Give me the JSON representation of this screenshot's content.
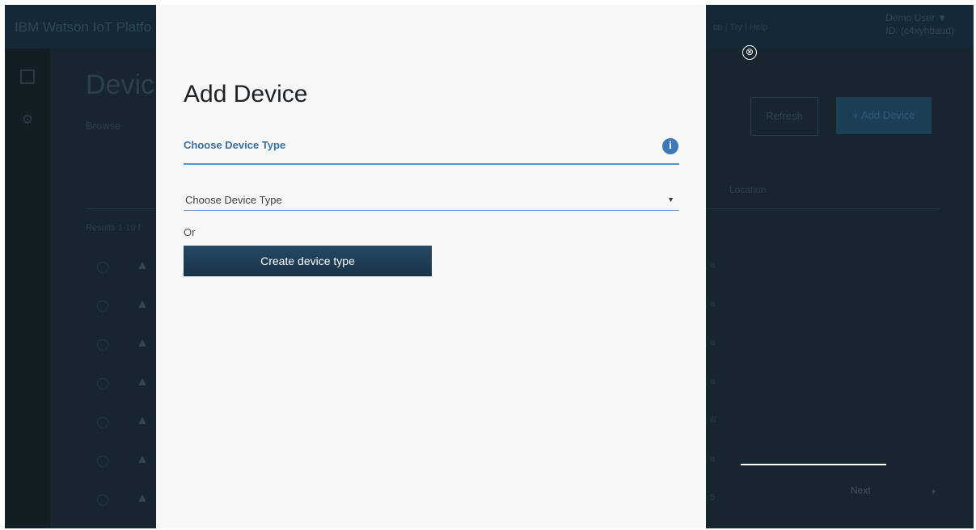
{
  "background": {
    "brand": "IBM Watson IoT Platfo",
    "user_name": "Demo User ▼",
    "org_id": "ID: (c4xyhbaud)",
    "topbar_links": "ce  |  Try  |  Help",
    "page_title": "Devic",
    "browse_tab": "Browse",
    "refresh_label": "Refresh",
    "add_device_label": "+ Add Device",
    "location_header": "Location",
    "results_text": "Results 1-10 f",
    "row_fragments": [
      "a",
      "a",
      "a",
      "a",
      "ill",
      "a",
      "5"
    ],
    "next_label": "Next"
  },
  "modal": {
    "title": "Add Device",
    "section_label": "Choose Device Type",
    "select_placeholder": "Choose Device Type",
    "or_text": "Or",
    "create_button": "Create device type",
    "close_icon": "⊗"
  },
  "icons": {
    "info": "i",
    "warning": "▲"
  },
  "colors": {
    "accent_blue": "#3e79b5",
    "button_navy": "#1f3f58",
    "overlay_bg": "#17252e"
  }
}
